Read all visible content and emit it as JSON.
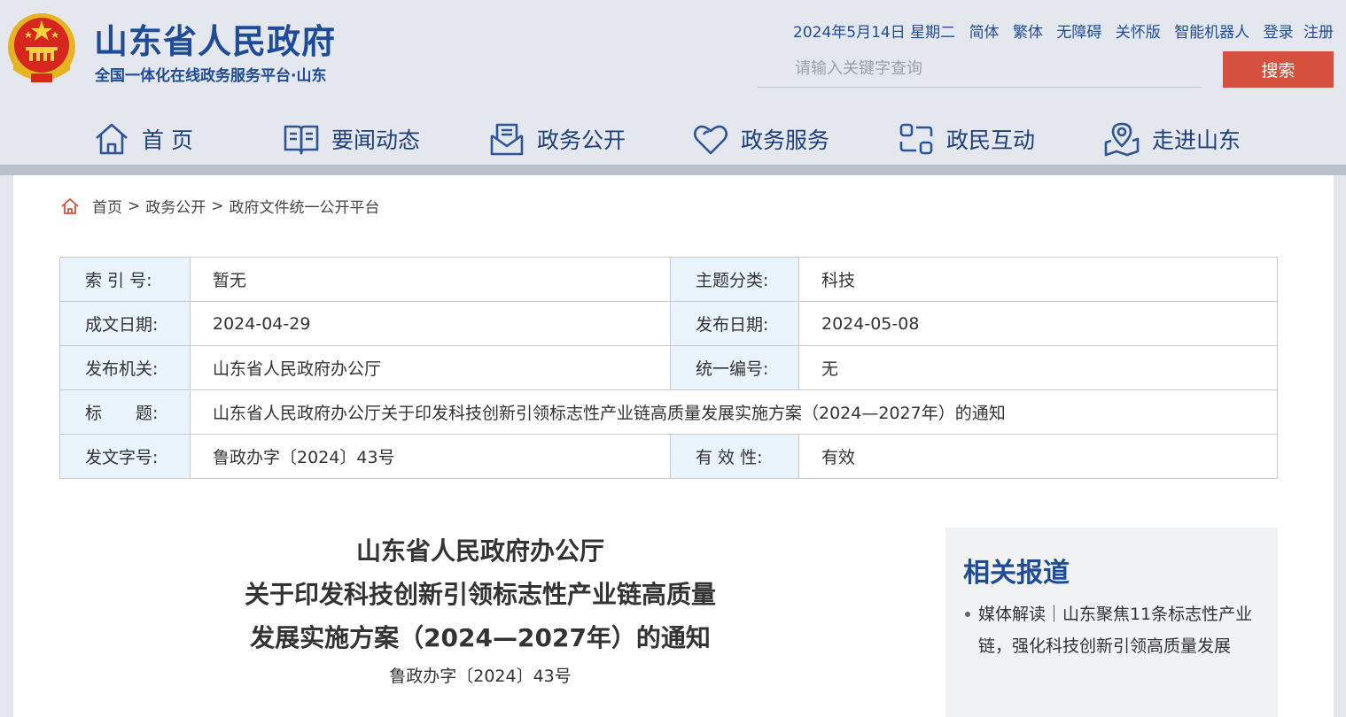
{
  "header": {
    "site_title": "山东省人民政府",
    "site_subtitle": "全国一体化在线政务服务平台·山东",
    "date": "2024年5月14日 星期二",
    "links": [
      "简体",
      "繁体",
      "无障碍",
      "关怀版",
      "智能机器人",
      "登录",
      "注册"
    ],
    "search_placeholder": "请输入关键字查询",
    "search_button": "搜索"
  },
  "nav": {
    "items": [
      {
        "label": "首 页",
        "icon": "home-icon"
      },
      {
        "label": "要闻动态",
        "icon": "book-icon"
      },
      {
        "label": "政务公开",
        "icon": "envelope-icon"
      },
      {
        "label": "政务服务",
        "icon": "heart-icon"
      },
      {
        "label": "政民互动",
        "icon": "interaction-icon"
      },
      {
        "label": "走进山东",
        "icon": "map-pin-icon"
      }
    ]
  },
  "breadcrumb": [
    "首页",
    "政务公开",
    "政府文件统一公开平台"
  ],
  "meta": {
    "index_label": "索 引 号:",
    "index_value": "暂无",
    "topic_label": "主题分类:",
    "topic_value": "科技",
    "written_label": "成文日期:",
    "written_value": "2024-04-29",
    "published_label": "发布日期:",
    "published_value": "2024-05-08",
    "issuer_label": "发布机关:",
    "issuer_value": "山东省人民政府办公厅",
    "serial_label": "统一编号:",
    "serial_value": "无",
    "title_label": "标　　题:",
    "title_value": "山东省人民政府办公厅关于印发科技创新引领标志性产业链高质量发展实施方案（2024—2027年）的通知",
    "docno_label": "发文字号:",
    "docno_value": "鲁政办字〔2024〕43号",
    "validity_label": "有 效 性:",
    "validity_value": "有效"
  },
  "article": {
    "title_line1": "山东省人民政府办公厅",
    "title_line2": "关于印发科技创新引领标志性产业链高质量",
    "title_line3": "发展实施方案（2024—2027年）的通知",
    "doc_no": "鲁政办字〔2024〕43号"
  },
  "related": {
    "heading": "相关报道",
    "items": [
      "媒体解读｜山东聚焦11条标志性产业链，强化科技创新引领高质量发展"
    ]
  },
  "colors": {
    "brand_blue": "#1f4c96",
    "accent_red": "#d6503e",
    "header_bg": "#e4e7ee",
    "label_bg": "#eaf4fc"
  }
}
